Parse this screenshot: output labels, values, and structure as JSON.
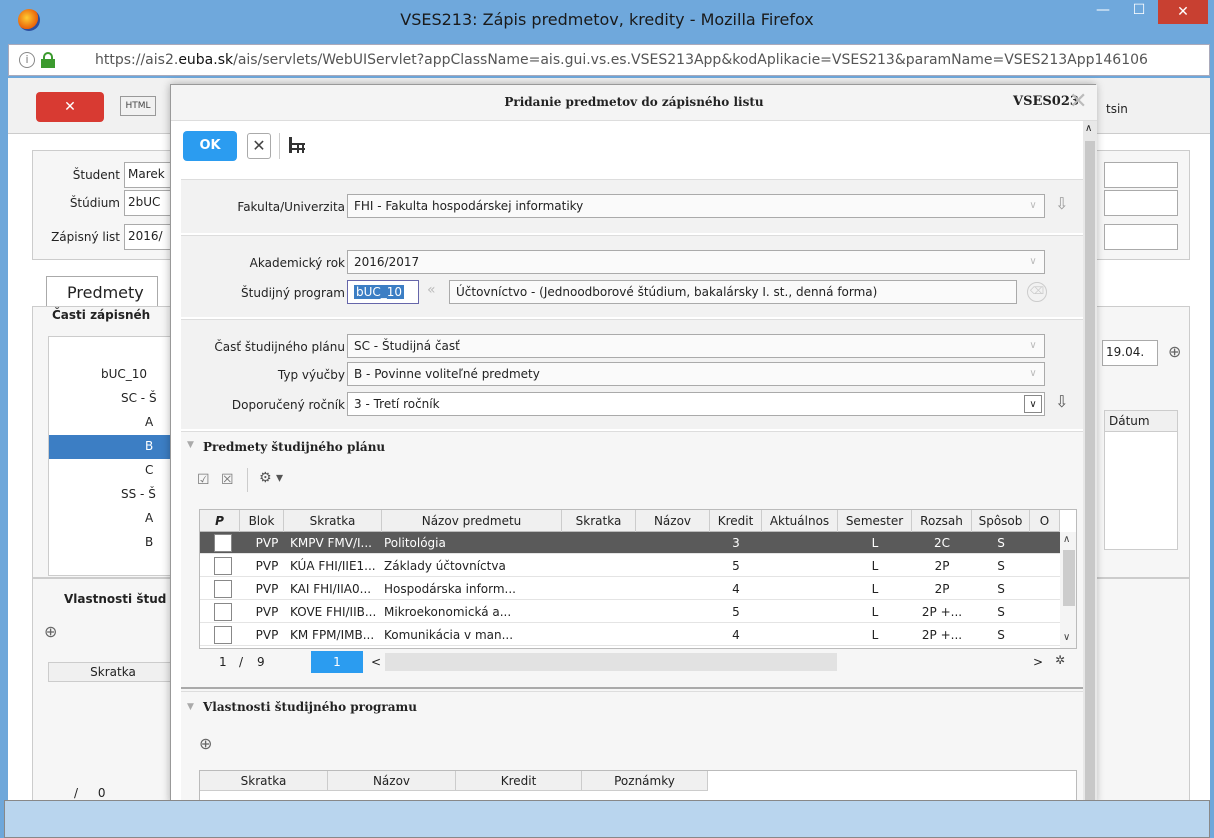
{
  "window": {
    "title": "VSES213: Zápis predmetov, kredity - Mozilla Firefox",
    "minimize": "—",
    "maximize": "☐",
    "close": "✕"
  },
  "url": {
    "prefix": "https://ais2.",
    "domain": "euba.sk",
    "rest": "/ais/servlets/WebUIServlet?appClassName=ais.gui.vs.es.VSES213App&kodAplikacie=VSES213&paramName=VSES213App146106"
  },
  "background": {
    "close_label": "✕",
    "html_label": "HTML",
    "student_label": "Študent",
    "student_value": "Marek",
    "studium_label": "Štúdium",
    "studium_value": "2bUC",
    "zapisny_label": "Zápisný list",
    "zapisny_value": "2016/",
    "tab_predmety": "Predmety",
    "casti_title": "Časti zápisnéh",
    "tree": [
      "bUC_10",
      "SC - Š",
      "A",
      "B",
      "C",
      "SS - Š",
      "A",
      "B"
    ],
    "vlastnosti": "Vlastnosti štud",
    "skratka": "Skratka",
    "pager_slash": "/",
    "pager_zero": "0",
    "date_value": "19.04.",
    "datum": "Dátum",
    "user_suffix": "tsin"
  },
  "modal": {
    "title": "Pridanie predmetov do zápisného listu",
    "code": "VSES023",
    "ok": "OK",
    "fakulta_label": "Fakulta/Univerzita",
    "fakulta_value": "FHI - Fakulta hospodárskej informatiky",
    "rok_label": "Akademický rok",
    "rok_value": "2016/2017",
    "program_label": "Študijný program",
    "program_code": "bUC_10",
    "program_name": "Účtovníctvo - (Jednoodborové štúdium, bakalársky I. st., denná forma)",
    "cast_label": "Časť študijného plánu",
    "cast_value": "SC - Študijná časť",
    "typ_label": "Typ výučby",
    "typ_value": "B - Povinne voliteľné predmety",
    "rocnik_label": "Doporučený ročník",
    "rocnik_value": "3 - Tretí ročník",
    "predmety_title": "Predmety študijného plánu",
    "columns": [
      "P",
      "Blok",
      "Skratka",
      "Názov predmetu",
      "Skratka",
      "Názov",
      "Kredit",
      "Aktuálnos",
      "Semester",
      "Rozsah",
      "Spôsob",
      "O"
    ],
    "rows": [
      {
        "blok": "PVP",
        "skratka": "KMPV FMV/I...",
        "nazov": "Politológia",
        "kredit": "3",
        "semester": "L",
        "rozsah": "2C",
        "sposob": "S"
      },
      {
        "blok": "PVP",
        "skratka": "KÚA FHI/IIE1...",
        "nazov": "Základy účtovníctva",
        "kredit": "5",
        "semester": "L",
        "rozsah": "2P",
        "sposob": "S"
      },
      {
        "blok": "PVP",
        "skratka": "KAI FHI/IIA0...",
        "nazov": "Hospodárska inform...",
        "kredit": "4",
        "semester": "L",
        "rozsah": "2P",
        "sposob": "S"
      },
      {
        "blok": "PVP",
        "skratka": "KOVE FHI/IIB...",
        "nazov": "Mikroekonomická a...",
        "kredit": "5",
        "semester": "L",
        "rozsah": "2P +...",
        "sposob": "S"
      },
      {
        "blok": "PVP",
        "skratka": "KM FPM/IMB...",
        "nazov": "Komunikácia v man...",
        "kredit": "4",
        "semester": "L",
        "rozsah": "2P +...",
        "sposob": "S"
      }
    ],
    "pager": {
      "current": "1",
      "slash": "/",
      "total": "9",
      "page": "1",
      "prev": "<",
      "next": ">"
    },
    "vlastnosti_title": "Vlastnosti študijného programu",
    "bottom_columns": [
      "Skratka",
      "Názov",
      "Kredit",
      "Poznámky"
    ]
  },
  "colors": {
    "accent": "#2b9cf0",
    "close": "#d83a32",
    "selected_row": "#5a5a5a",
    "titlebar": "#6fa8dc"
  },
  "icons": [
    "firefox-icon",
    "lock-icon",
    "search-plus-icon",
    "table-icon",
    "check-all-icon",
    "uncheck-all-icon",
    "filter-icon"
  ]
}
